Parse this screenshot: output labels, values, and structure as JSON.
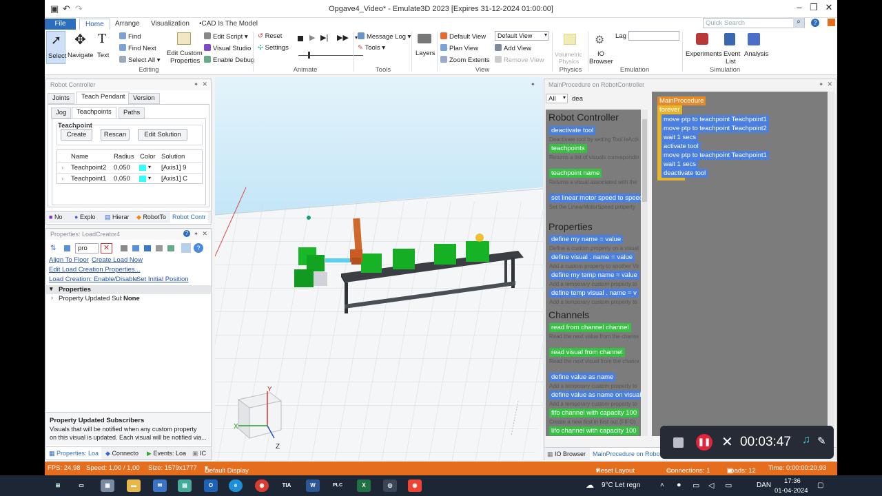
{
  "window": {
    "title": "Opgave4_Video* - Emulate3D 2023 [Expires 31-12-2024 01:00:00]",
    "quick_search_placeholder": "Quick Search"
  },
  "ribbon_tabs": [
    "File",
    "Home",
    "Arrange",
    "Visualization",
    "•CAD Is The Model"
  ],
  "ribbon": {
    "select": "Select",
    "navigate": "Navigate",
    "text": "Text",
    "find": "Find",
    "find_next": "Find Next",
    "select_all": "Select All",
    "edit_custom": "Edit Custom",
    "properties": "Properties",
    "edit_script": "Edit Script",
    "visual_studio": "Visual Studio",
    "enable_debug": "Enable Debug",
    "reset": "Reset",
    "settings": "Settings",
    "message_log": "Message Log",
    "tools": "Tools",
    "layers": "Layers",
    "default_view": "Default View",
    "plan_view": "Plan View",
    "zoom_extents": "Zoom Extents",
    "default_view_select": "Default View",
    "add_view": "Add View",
    "remove_view": "Remove View",
    "volumetric": "Volumetric",
    "physics_sub": "Physics",
    "io_browser": "IO",
    "browser": "Browser",
    "lag": "Lag",
    "experiments": "Experiments",
    "event": "Event",
    "list": "List",
    "analysis": "Analysis",
    "groups": [
      "Editing",
      "Animate",
      "Tools",
      "View",
      "Physics",
      "Emulation",
      "Simulation"
    ]
  },
  "robot_controller": {
    "title": "Robot Controller",
    "tabs": [
      "Joints",
      "Teach Pendant",
      "Version"
    ],
    "subtabs": [
      "Jog",
      "Teachpoints",
      "Paths"
    ],
    "group": "Teachpoint",
    "buttons": [
      "Create",
      "Rescan",
      "Edit Solution"
    ],
    "headers": [
      "Name",
      "Radius",
      "Color",
      "Solution"
    ],
    "rows": [
      {
        "name": "Teachpoint2",
        "radius": "0,050",
        "solution": "[Axis1] 9"
      },
      {
        "name": "Teachpoint1",
        "radius": "0,050",
        "solution": "[Axis1] C"
      }
    ],
    "bottom_tabs": [
      "No",
      "Explo",
      "Hierar",
      "RobotTo",
      "Robot Contr"
    ]
  },
  "properties_panel": {
    "title": "Properties: LoadCreator4",
    "search": "pro",
    "links": [
      "Align To Floor",
      "Create Load Now",
      "Edit Load Creation Properties...",
      "Load Creation: Enable/Disable",
      "Set Initial Position"
    ],
    "section": "Properties",
    "prop_name": "Property Updated Subs",
    "prop_value": "None",
    "help_title": "Property Updated Subscribers",
    "help_text1": "Visuals that will be notified when any custom property",
    "help_text2": "on this visual is updated. Each visual will be notified via...",
    "bottom_tabs": [
      "Properties: Loa",
      "Connecto",
      "Events: Loa",
      "IC"
    ]
  },
  "script_panel": {
    "title": "MainProcedure on RobotController",
    "filter": "All",
    "search": "dea",
    "sections": [
      "Robot Controller",
      "Properties",
      "Channels"
    ],
    "palette": [
      {
        "text": "deactivate tool",
        "desc": "Deactivate tool by setting Tool.IsActive"
      },
      {
        "text": "teachpoints",
        "desc": "Returns a list of visuals corresponding"
      },
      {
        "text": "teachpoint name",
        "desc": "Returns a visual associated with the"
      },
      {
        "text": "set linear motor speed to speed",
        "desc": "Set the LinearMotorSpeed property"
      },
      {
        "text": "define my name = value",
        "desc": "Define a custom property on a visual"
      },
      {
        "text": "define visual . name = value",
        "desc": "Add a custom property to another Visual"
      },
      {
        "text": "define my temp name = value",
        "desc": "Add a temporary custom property to"
      },
      {
        "text": "define temp visual . name = v",
        "desc": "Add a temporary custom property to"
      },
      {
        "text": "read from channel channel",
        "desc": "Read the next value from the channel"
      },
      {
        "text": "read visual from channel",
        "desc": "Read the next visual from the channel"
      },
      {
        "text": "define value as name",
        "desc": "Add a temporary custom property to"
      },
      {
        "text": "define value as name on visual",
        "desc": "Add a temporary custom property to"
      },
      {
        "text": "fifo channel with capacity 100",
        "desc": "Create a new first in first out (FIFO)"
      },
      {
        "text": "lifo channel with capacity 100",
        "desc": ""
      }
    ],
    "program": {
      "name": "MainProcedure",
      "loop": "forever",
      "lines": [
        "move ptp to teachpoint Teachpoint1",
        "move ptp to teachpoint Teachpoint2",
        "wait 1 secs",
        "activate tool",
        "move ptp to teachpoint Teachpoint1",
        "wait 1 secs",
        "deactivate tool"
      ]
    },
    "bottom_tabs": [
      "IO Browser",
      "MainProcedure on Robot"
    ]
  },
  "viewport": {
    "axis_labels": [
      "Y",
      "X",
      "Z"
    ]
  },
  "recorder": {
    "time": "00:03:47"
  },
  "status": {
    "fps": "FPS: 24,98",
    "speed": "Speed: 1,00 / 1,00",
    "size": "Size: 1579x1777",
    "display": "Default Display",
    "reset_layout": "Reset Layout",
    "connections": "Connections: 1",
    "loads": "Loads: 12",
    "time": "Time: 0:00:00:20,93"
  },
  "taskbar": {
    "weather": "9°C Let regn",
    "lang": "DAN",
    "clock": "17:36",
    "date": "01-04-2024"
  }
}
